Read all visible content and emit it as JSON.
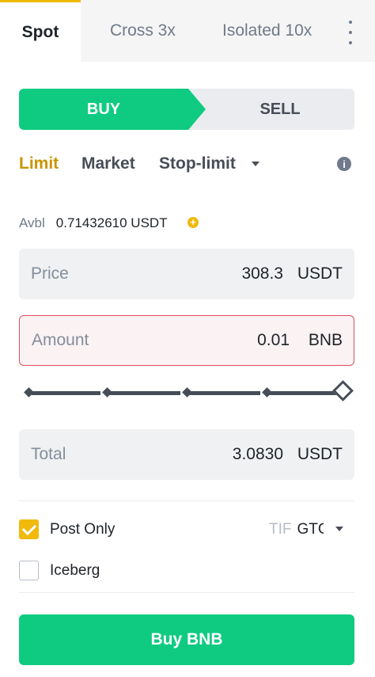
{
  "tabs": [
    {
      "label": "Spot",
      "active": true
    },
    {
      "label": "Cross 3x"
    },
    {
      "label": "Isolated 10x"
    }
  ],
  "side": {
    "buy": "BUY",
    "sell": "SELL",
    "selected": "buy"
  },
  "order_types": {
    "limit": "Limit",
    "market": "Market",
    "stop_limit": "Stop-limit",
    "selected": "limit"
  },
  "available": {
    "label": "Avbl",
    "value": "0.71432610 USDT"
  },
  "price": {
    "label": "Price",
    "value": "308.3",
    "unit": "USDT"
  },
  "amount": {
    "label": "Amount",
    "value": "0.01",
    "unit": "BNB"
  },
  "slider": {
    "percent": 100
  },
  "total": {
    "label": "Total",
    "value": "3.0830",
    "unit": "USDT"
  },
  "options": {
    "post_only": {
      "label": "Post Only",
      "checked": true
    },
    "iceberg": {
      "label": "Iceberg",
      "checked": false
    }
  },
  "tif": {
    "label": "TIF",
    "value": "GTC"
  },
  "submit": {
    "label": "Buy BNB"
  },
  "colors": {
    "buy_green": "#0ecb81",
    "accent_yellow": "#f0b90b",
    "error_red": "#e14e60"
  }
}
